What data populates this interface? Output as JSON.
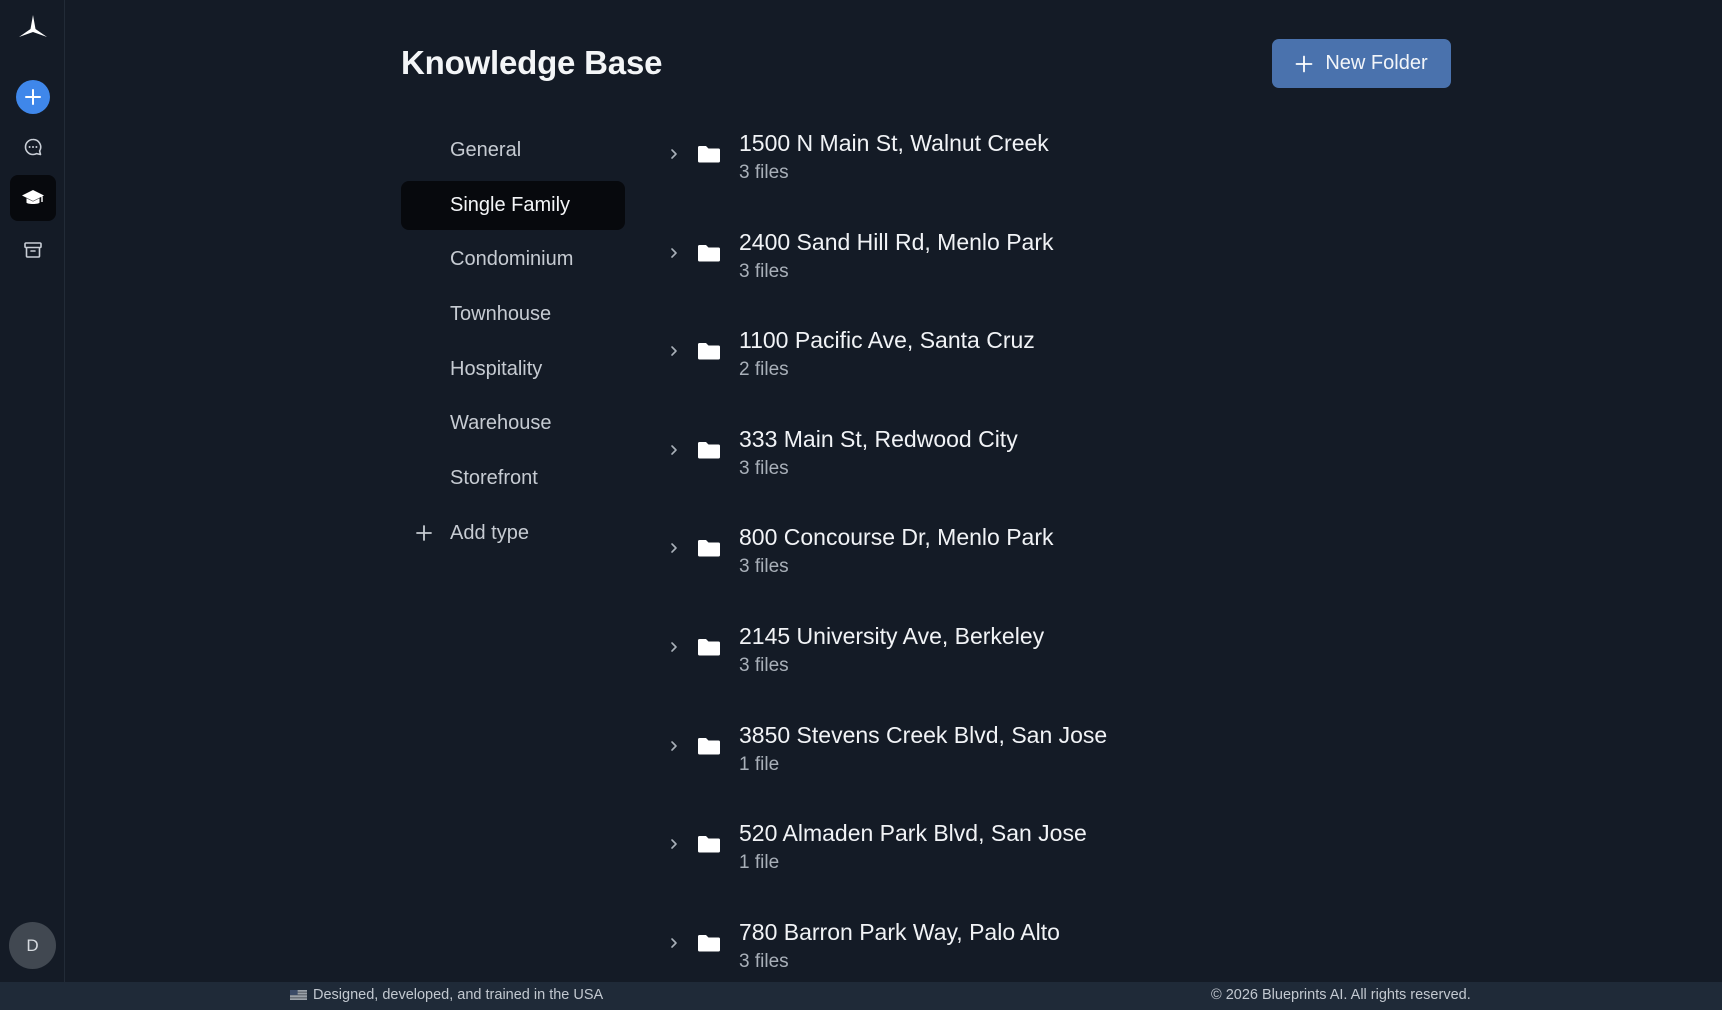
{
  "header": {
    "title": "Knowledge Base",
    "new_folder_label": "New Folder"
  },
  "rail": {
    "avatar_initial": "D",
    "items": [
      {
        "icon": "new-chat-plus-icon",
        "active": false
      },
      {
        "icon": "chat-bubble-icon",
        "active": false
      },
      {
        "icon": "graduation-cap-icon",
        "active": true
      },
      {
        "icon": "archive-box-icon",
        "active": false
      }
    ]
  },
  "types": {
    "items": [
      "General",
      "Single Family",
      "Condominium",
      "Townhouse",
      "Hospitality",
      "Warehouse",
      "Storefront"
    ],
    "selected": "Single Family",
    "add_label": "Add type"
  },
  "folders": [
    {
      "name": "1500 N Main St, Walnut Creek",
      "count": "3 files"
    },
    {
      "name": "2400 Sand Hill Rd, Menlo Park",
      "count": "3 files"
    },
    {
      "name": "1100 Pacific Ave, Santa Cruz",
      "count": "2 files"
    },
    {
      "name": "333 Main St, Redwood City",
      "count": "3 files"
    },
    {
      "name": "800 Concourse Dr, Menlo Park",
      "count": "3 files"
    },
    {
      "name": "2145 University Ave, Berkeley",
      "count": "3 files"
    },
    {
      "name": "3850 Stevens Creek Blvd, San Jose",
      "count": "1 file"
    },
    {
      "name": "520 Almaden Park Blvd, San Jose",
      "count": "1 file"
    },
    {
      "name": "780 Barron Park Way, Palo Alto",
      "count": "3 files"
    }
  ],
  "footer": {
    "left": "Designed, developed, and trained in the USA",
    "right": "© 2026 Blueprints AI. All rights reserved."
  },
  "colors": {
    "background": "#141b26",
    "accent": "#3f87ea",
    "button": "#4a72ad",
    "active_item": "#07090d",
    "footer": "#1f2a38"
  }
}
